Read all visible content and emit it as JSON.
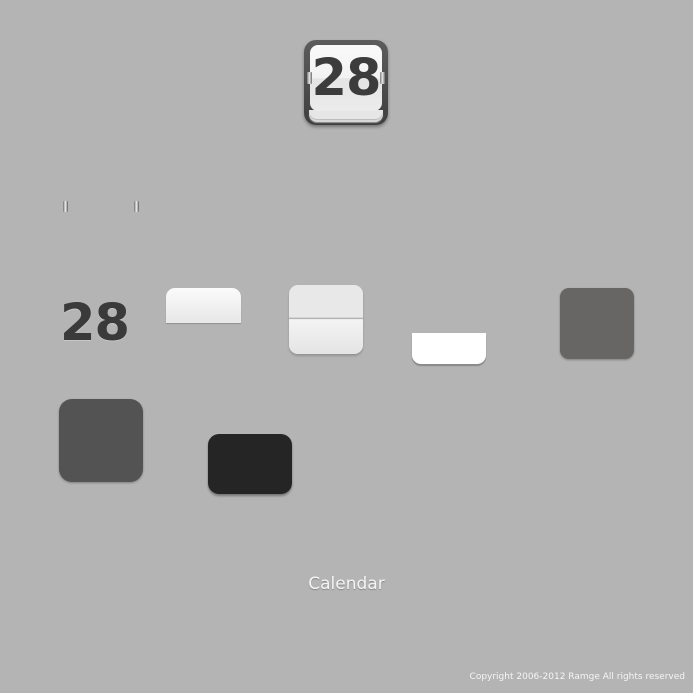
{
  "icon": {
    "date_number": "28"
  },
  "parts": {
    "number_label": "28"
  },
  "caption": "Calendar",
  "copyright": "Copyright 2006-2012 Ramge All rights reserved",
  "colors": {
    "background": "#b4b4b4",
    "frame": "#4a4a4a",
    "page": "#f4f4f4",
    "digit": "#3c3c3c",
    "tile_gray": "#686565",
    "tile_large": "#535353",
    "tile_dark": "#252525",
    "caption_text": "#f4f4f4"
  }
}
